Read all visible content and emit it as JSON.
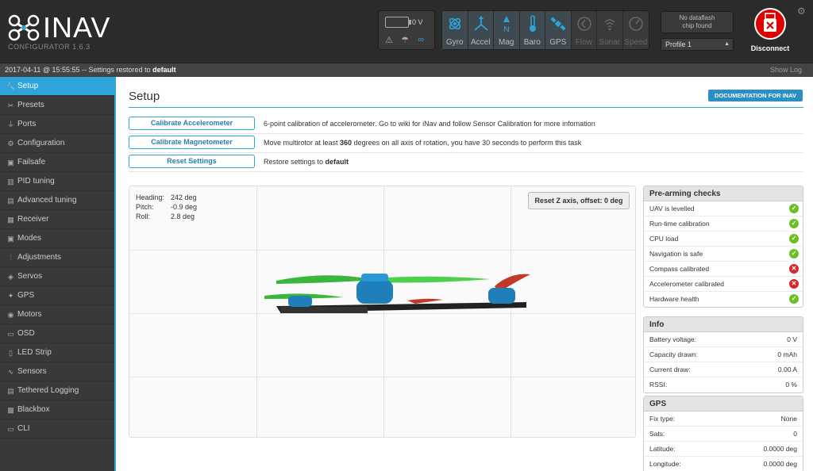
{
  "app": {
    "brand": "INAV",
    "subtitle": "CONFIGURATOR  1.6.3"
  },
  "header": {
    "battery_voltage": "0 V",
    "sensors": [
      {
        "label": "Gyro",
        "state": "on",
        "icon": "gyro-icon"
      },
      {
        "label": "Accel",
        "state": "on",
        "icon": "accel-icon"
      },
      {
        "label": "Mag",
        "state": "on",
        "icon": "mag-icon"
      },
      {
        "label": "Baro",
        "state": "on",
        "icon": "baro-icon"
      },
      {
        "label": "GPS",
        "state": "on",
        "icon": "gps-icon"
      },
      {
        "label": "Flow",
        "state": "off",
        "icon": "flow-icon"
      },
      {
        "label": "Sonar",
        "state": "off",
        "icon": "sonar-icon"
      },
      {
        "label": "Speed",
        "state": "off",
        "icon": "speed-icon"
      }
    ],
    "dataflash_line1": "No dataflash",
    "dataflash_line2": "chip found",
    "profile": "Profile 1",
    "connect_label": "Disconnect"
  },
  "log": {
    "message": "2017-04-11 @ 15:55:55 -- Settings restored to ",
    "message_bold": "default",
    "show_log": "Show Log"
  },
  "sidebar": {
    "items": [
      {
        "label": "Setup",
        "icon": "wrench-icon",
        "active": true
      },
      {
        "label": "Presets",
        "icon": "presets-icon"
      },
      {
        "label": "Ports",
        "icon": "plug-icon"
      },
      {
        "label": "Configuration",
        "icon": "gear-icon"
      },
      {
        "label": "Failsafe",
        "icon": "failsafe-icon"
      },
      {
        "label": "PID tuning",
        "icon": "pid-icon"
      },
      {
        "label": "Advanced tuning",
        "icon": "advanced-icon"
      },
      {
        "label": "Receiver",
        "icon": "receiver-icon"
      },
      {
        "label": "Modes",
        "icon": "modes-icon"
      },
      {
        "label": "Adjustments",
        "icon": "sliders-icon"
      },
      {
        "label": "Servos",
        "icon": "servo-icon"
      },
      {
        "label": "GPS",
        "icon": "gps-icon"
      },
      {
        "label": "Motors",
        "icon": "motor-icon"
      },
      {
        "label": "OSD",
        "icon": "osd-icon"
      },
      {
        "label": "LED Strip",
        "icon": "led-icon"
      },
      {
        "label": "Sensors",
        "icon": "sensors-icon"
      },
      {
        "label": "Tethered Logging",
        "icon": "log-icon"
      },
      {
        "label": "Blackbox",
        "icon": "blackbox-icon"
      },
      {
        "label": "CLI",
        "icon": "cli-icon"
      }
    ]
  },
  "main": {
    "title": "Setup",
    "doc_button": "DOCUMENTATION FOR INAV",
    "calibrations": [
      {
        "button": "Calibrate Accelerometer",
        "desc": "6-point calibration of accelerometer. Go to wiki for iNav and follow Sensor Calibration for more infomation",
        "desc_pre": "6-point calibration of accelerometer. Go to wiki for iNav and follow Sensor Calibration for more infomation",
        "bold": "",
        "desc_post": ""
      },
      {
        "button": "Calibrate Magnetometer",
        "desc_pre": "Move multirotor at least ",
        "bold": "360",
        "desc_post": " degrees on all axis of rotation, you have 30 seconds to perform this task"
      },
      {
        "button": "Reset Settings",
        "desc_pre": "Restore settings to ",
        "bold": "default",
        "desc_post": ""
      }
    ],
    "attitude": {
      "heading_label": "Heading:",
      "heading": "242 deg",
      "pitch_label": "Pitch:",
      "pitch": "-0.9 deg",
      "roll_label": "Roll:",
      "roll": "2.8 deg"
    },
    "reset_z": "Reset Z axis, offset: 0 deg"
  },
  "prearm": {
    "title": "Pre-arming checks",
    "items": [
      {
        "label": "UAV is levelled",
        "ok": true
      },
      {
        "label": "Run-time calibration",
        "ok": true
      },
      {
        "label": "CPU load",
        "ok": true
      },
      {
        "label": "Navigation is safe",
        "ok": true
      },
      {
        "label": "Compass calibrated",
        "ok": false
      },
      {
        "label": "Accelerometer calibrated",
        "ok": false
      },
      {
        "label": "Hardware health",
        "ok": true
      }
    ]
  },
  "info": {
    "title": "Info",
    "rows": [
      {
        "label": "Battery voltage:",
        "value": "0 V"
      },
      {
        "label": "Capacity drawn:",
        "value": "0 mAh"
      },
      {
        "label": "Current draw:",
        "value": "0.00 A"
      },
      {
        "label": "RSSI:",
        "value": "0 %"
      }
    ]
  },
  "gps": {
    "title": "GPS",
    "rows": [
      {
        "label": "Fix type:",
        "value": "None"
      },
      {
        "label": "Sats:",
        "value": "0"
      },
      {
        "label": "Latitude:",
        "value": "0.0000 deg"
      },
      {
        "label": "Longitude:",
        "value": "0.0000 deg"
      }
    ]
  },
  "colors": {
    "accent": "#2ea4db",
    "ok": "#6cbf24",
    "bad": "#d52a2a",
    "connect": "#dd0000"
  }
}
